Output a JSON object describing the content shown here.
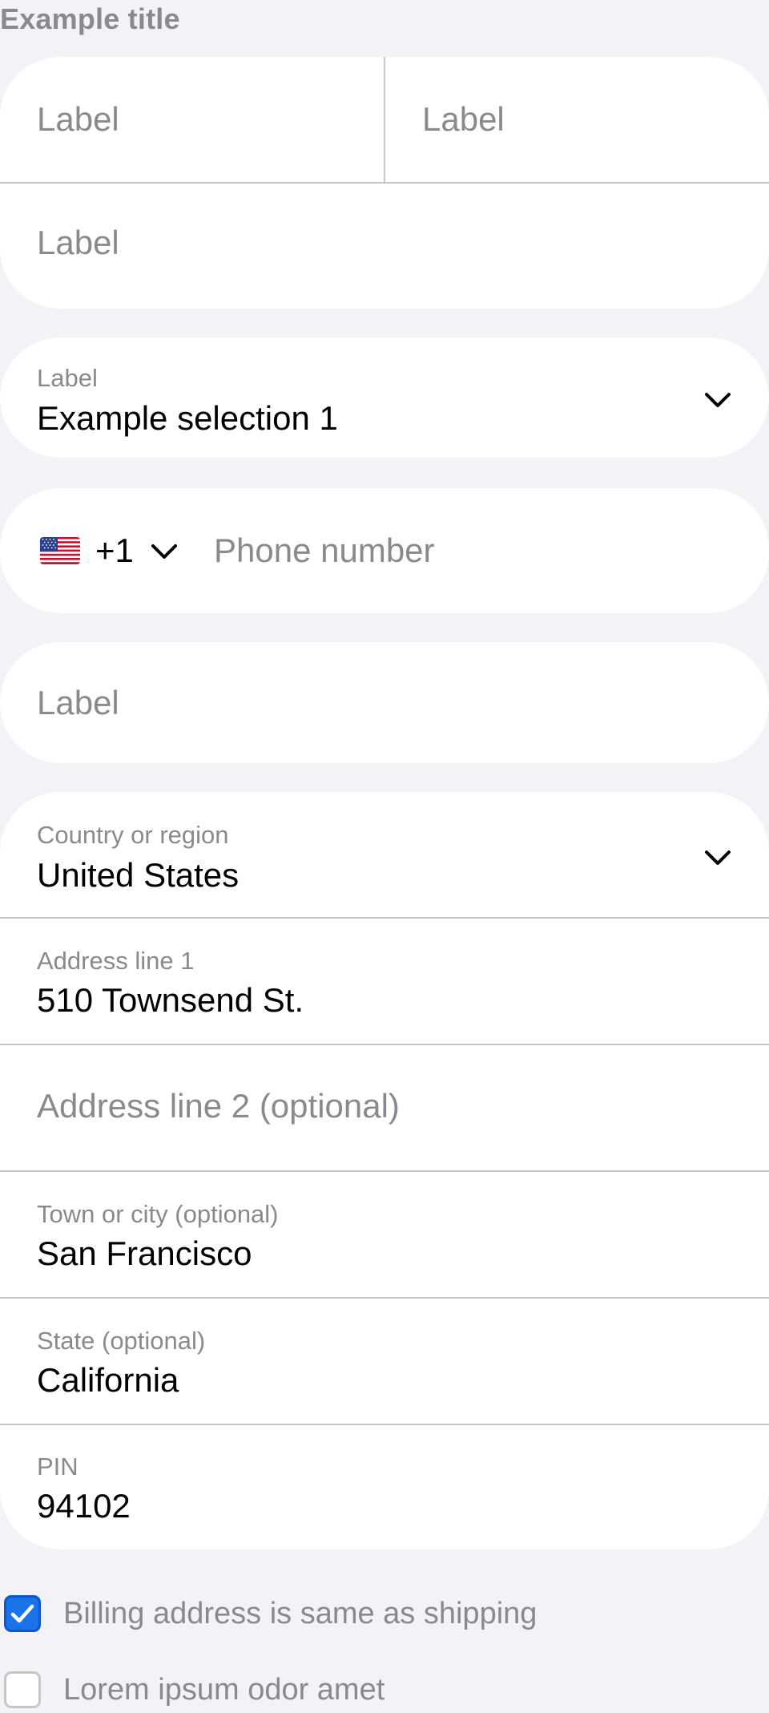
{
  "page": {
    "title": "Example title"
  },
  "name_group": {
    "first": {
      "placeholder": "Label"
    },
    "last": {
      "placeholder": "Label"
    },
    "full": {
      "placeholder": "Label"
    }
  },
  "dropdown": {
    "label": "Label",
    "value": "Example selection 1",
    "icon": "chevron-down-icon"
  },
  "phone": {
    "country_flag": "US",
    "country_code": "+1",
    "placeholder": "Phone number",
    "icon": "chevron-down-icon"
  },
  "single_field": {
    "placeholder": "Label"
  },
  "address": {
    "country": {
      "label": "Country or region",
      "value": "United States"
    },
    "line1": {
      "label": "Address line 1",
      "value": "510 Townsend St."
    },
    "line2": {
      "placeholder": "Address line 2 (optional)"
    },
    "city": {
      "label": "Town or city (optional)",
      "value": "San Francisco"
    },
    "state": {
      "label": "State (optional)",
      "value": "California"
    },
    "pin": {
      "label": "PIN",
      "value": "94102"
    }
  },
  "checkboxes": [
    {
      "label": "Billing address is same as shipping",
      "checked": true
    },
    {
      "label": "Lorem ipsum odor amet",
      "checked": false
    }
  ],
  "colors": {
    "background": "#f2f2f7",
    "card": "#ffffff",
    "separator": "#c6c6c8",
    "placeholder": "#8a8a8e",
    "accent": "#1a73e8"
  }
}
